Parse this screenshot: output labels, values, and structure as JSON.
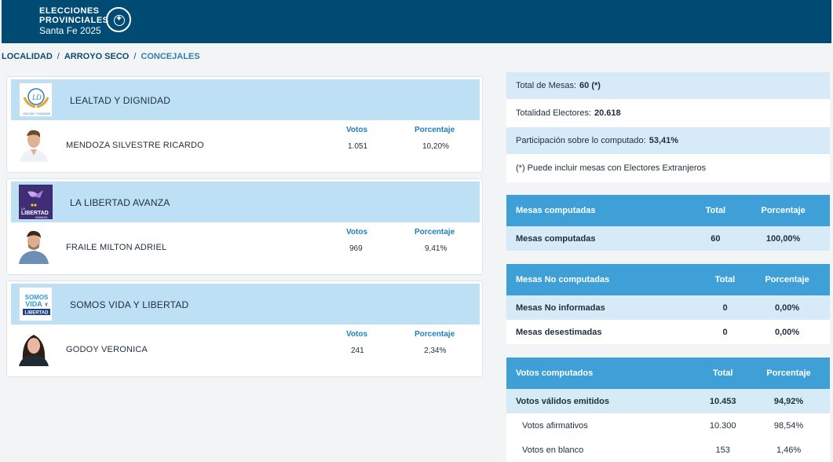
{
  "header": {
    "line1": "ELECCIONES",
    "line2": "PROVINCIALES",
    "line3": "Santa Fe 2025"
  },
  "breadcrumb": [
    "LOCALIDAD",
    "ARROYO SECO",
    "CONCEJALES"
  ],
  "columns": {
    "votes": "Votos",
    "percent": "Porcentaje"
  },
  "parties": [
    {
      "name": "LEALTAD Y DIGNIDAD",
      "logo_text": "LEALTAD Y DIGNIDAD",
      "candidate": "MENDOZA SILVESTRE RICARDO",
      "votes": "1.051",
      "percent": "10,20%"
    },
    {
      "name": "LA LIBERTAD AVANZA",
      "logo_text": "LA LIBERTAD AVANZA",
      "candidate": "FRAILE MILTON ADRIEL",
      "votes": "969",
      "percent": "9,41%"
    },
    {
      "name": "SOMOS VIDA Y LIBERTAD",
      "logo_text": "SOMOS VIDA Y LIBERTAD",
      "candidate": "GODOY VERONICA",
      "votes": "241",
      "percent": "2,34%"
    }
  ],
  "summary": {
    "total_mesas_label": "Total de Mesas:",
    "total_mesas_value": "60 (*)",
    "electores_label": "Totalidad Electores:",
    "electores_value": "20.618",
    "participacion_label": "Participación sobre lo computado:",
    "participacion_value": "53,41%",
    "note": "(*) Puede incluir mesas con Electores Extranjeros"
  },
  "tables": {
    "total_h": "Total",
    "pct_h": "Porcentaje",
    "mesas_computadas": {
      "title": "Mesas computadas",
      "rows": [
        {
          "label": "Mesas computadas",
          "total": "60",
          "pct": "100,00%"
        }
      ]
    },
    "mesas_no": {
      "title": "Mesas No computadas",
      "rows": [
        {
          "label": "Mesas No informadas",
          "total": "0",
          "pct": "0,00%"
        },
        {
          "label": "Mesas desestimadas",
          "total": "0",
          "pct": "0,00%"
        }
      ]
    },
    "votos": {
      "title": "Votos computados",
      "rows": [
        {
          "label": "Votos válidos emitidos",
          "total": "10.453",
          "pct": "94,92%"
        },
        {
          "label": "Votos afirmativos",
          "total": "10.300",
          "pct": "98,54%"
        },
        {
          "label": "Votos en blanco",
          "total": "153",
          "pct": "1,46%"
        }
      ]
    }
  }
}
